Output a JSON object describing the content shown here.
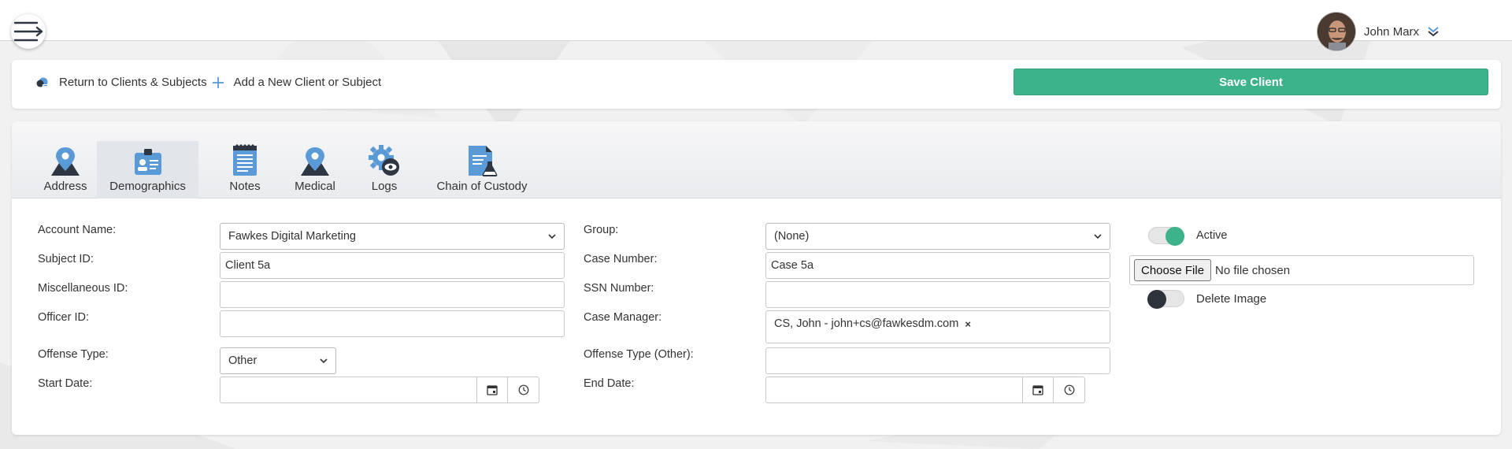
{
  "header": {
    "user_name": "John Marx"
  },
  "actions": {
    "return_label": "Return to Clients & Subjects",
    "add_label": "Add a New Client or Subject",
    "save_label": "Save Client"
  },
  "tabs": [
    {
      "label": "Address",
      "icon": "map-pin-icon"
    },
    {
      "label": "Demographics",
      "icon": "id-badge-icon"
    },
    {
      "label": "Notes",
      "icon": "notepad-icon"
    },
    {
      "label": "Medical",
      "icon": "map-pin-icon"
    },
    {
      "label": "Logs",
      "icon": "gear-eye-icon"
    },
    {
      "label": "Chain of Custody",
      "icon": "document-flask-icon"
    }
  ],
  "form": {
    "account_name": {
      "label": "Account Name:",
      "value": "Fawkes Digital Marketing"
    },
    "subject_id": {
      "label": "Subject ID:",
      "value": "Client 5a"
    },
    "misc_id": {
      "label": "Miscellaneous ID:",
      "value": ""
    },
    "officer_id": {
      "label": "Officer ID:",
      "value": ""
    },
    "offense_type": {
      "label": "Offense Type:",
      "value": "Other"
    },
    "start_date": {
      "label": "Start Date:",
      "value": ""
    },
    "group": {
      "label": "Group:",
      "value": "(None)"
    },
    "case_number": {
      "label": "Case Number:",
      "value": "Case 5a"
    },
    "ssn": {
      "label": "SSN Number:",
      "value": ""
    },
    "case_manager": {
      "label": "Case Manager:",
      "tag": "CS, John - john+cs@fawkesdm.com",
      "remove_glyph": "×"
    },
    "offense_type_other": {
      "label": "Offense Type (Other):",
      "value": ""
    },
    "end_date": {
      "label": "End Date:",
      "value": ""
    },
    "active": {
      "label": "Active",
      "on": true
    },
    "file": {
      "button": "Choose File",
      "status": "No file chosen"
    },
    "delete_image": {
      "label": "Delete Image",
      "on": false
    }
  },
  "colors": {
    "accent": "#3cb38a",
    "icon_blue": "#5a9ad6",
    "icon_dark": "#2d3642",
    "toggle_off_knob": "#2d333b"
  }
}
